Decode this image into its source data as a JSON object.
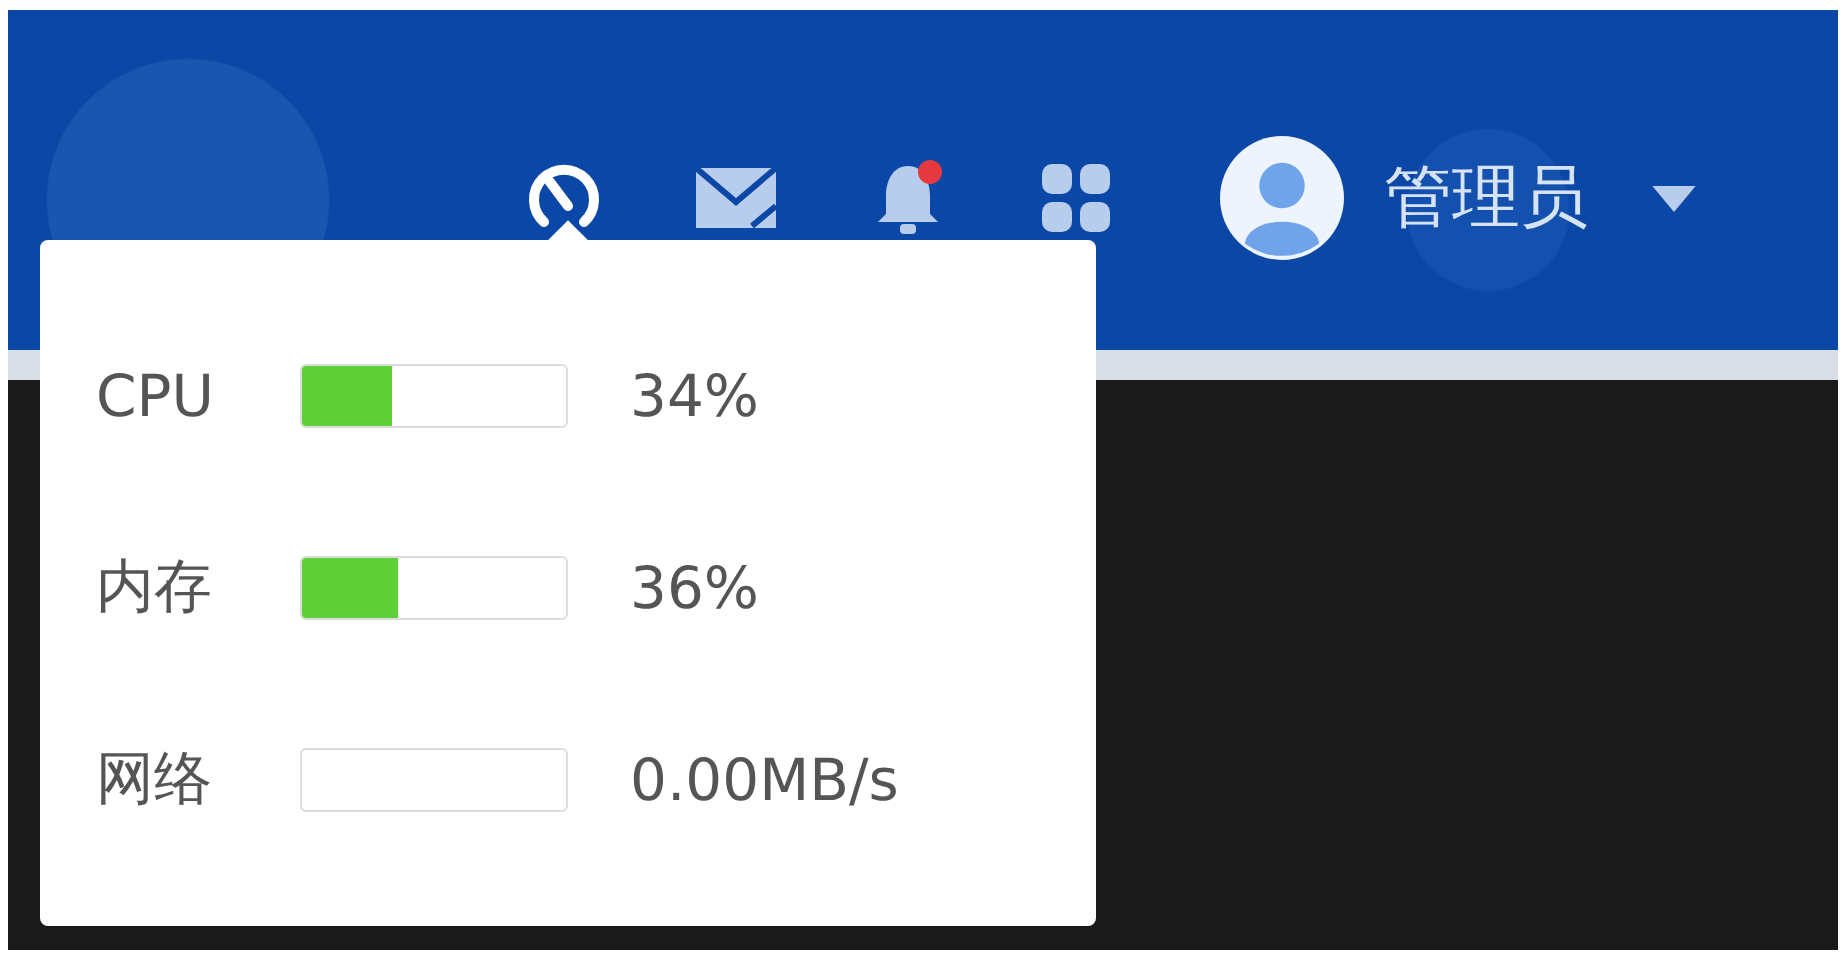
{
  "header": {
    "icons": [
      {
        "kind": "gauge"
      },
      {
        "kind": "mail"
      },
      {
        "kind": "bell",
        "notification_badge": true
      },
      {
        "kind": "apps"
      }
    ],
    "user_name": "管理员"
  },
  "popover": {
    "metrics": [
      {
        "label": "CPU",
        "level": 0.34,
        "reading": "34%"
      },
      {
        "label": "内存",
        "level": 0.36,
        "reading": "36%"
      },
      {
        "label": "网络",
        "level": 0,
        "reading": "0.00MB/s"
      }
    ]
  }
}
